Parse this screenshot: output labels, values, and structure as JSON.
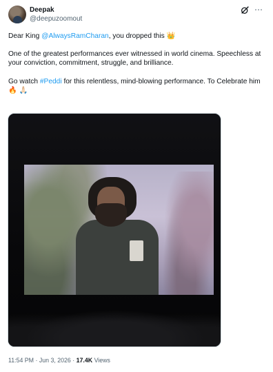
{
  "author": {
    "name": "Deepak",
    "handle": "@deepuzoomout"
  },
  "icons": {
    "grok": "grok-icon",
    "more": "more-icon",
    "crown": "crown-emoji",
    "fire": "fire-emoji",
    "pray": "folded-hands-emoji"
  },
  "tweet": {
    "line1_prefix": "Dear King ",
    "mention": "@AlwaysRamCharan",
    "line1_suffix": ", you dropped this ",
    "crown": "👑",
    "para2": "One of the greatest performances ever witnessed in world cinema. Speechless at your conviction, commitment, struggle, and brilliance.",
    "para3_prefix": "Go watch ",
    "hashtag": "#Peddi",
    "para3_suffix": " for this relentless, mind-blowing performance. To Celebrate him ",
    "fire": "🔥",
    "pray": "🙏🏻"
  },
  "meta": {
    "time": "11:54 PM",
    "sep1": " · ",
    "date": "Jun 3, 2026",
    "sep2": " · ",
    "views_count": "17.4K",
    "views_label": " Views"
  },
  "colors": {
    "link": "#1d9bf0",
    "text": "#0f1419",
    "secondary": "#536471"
  }
}
